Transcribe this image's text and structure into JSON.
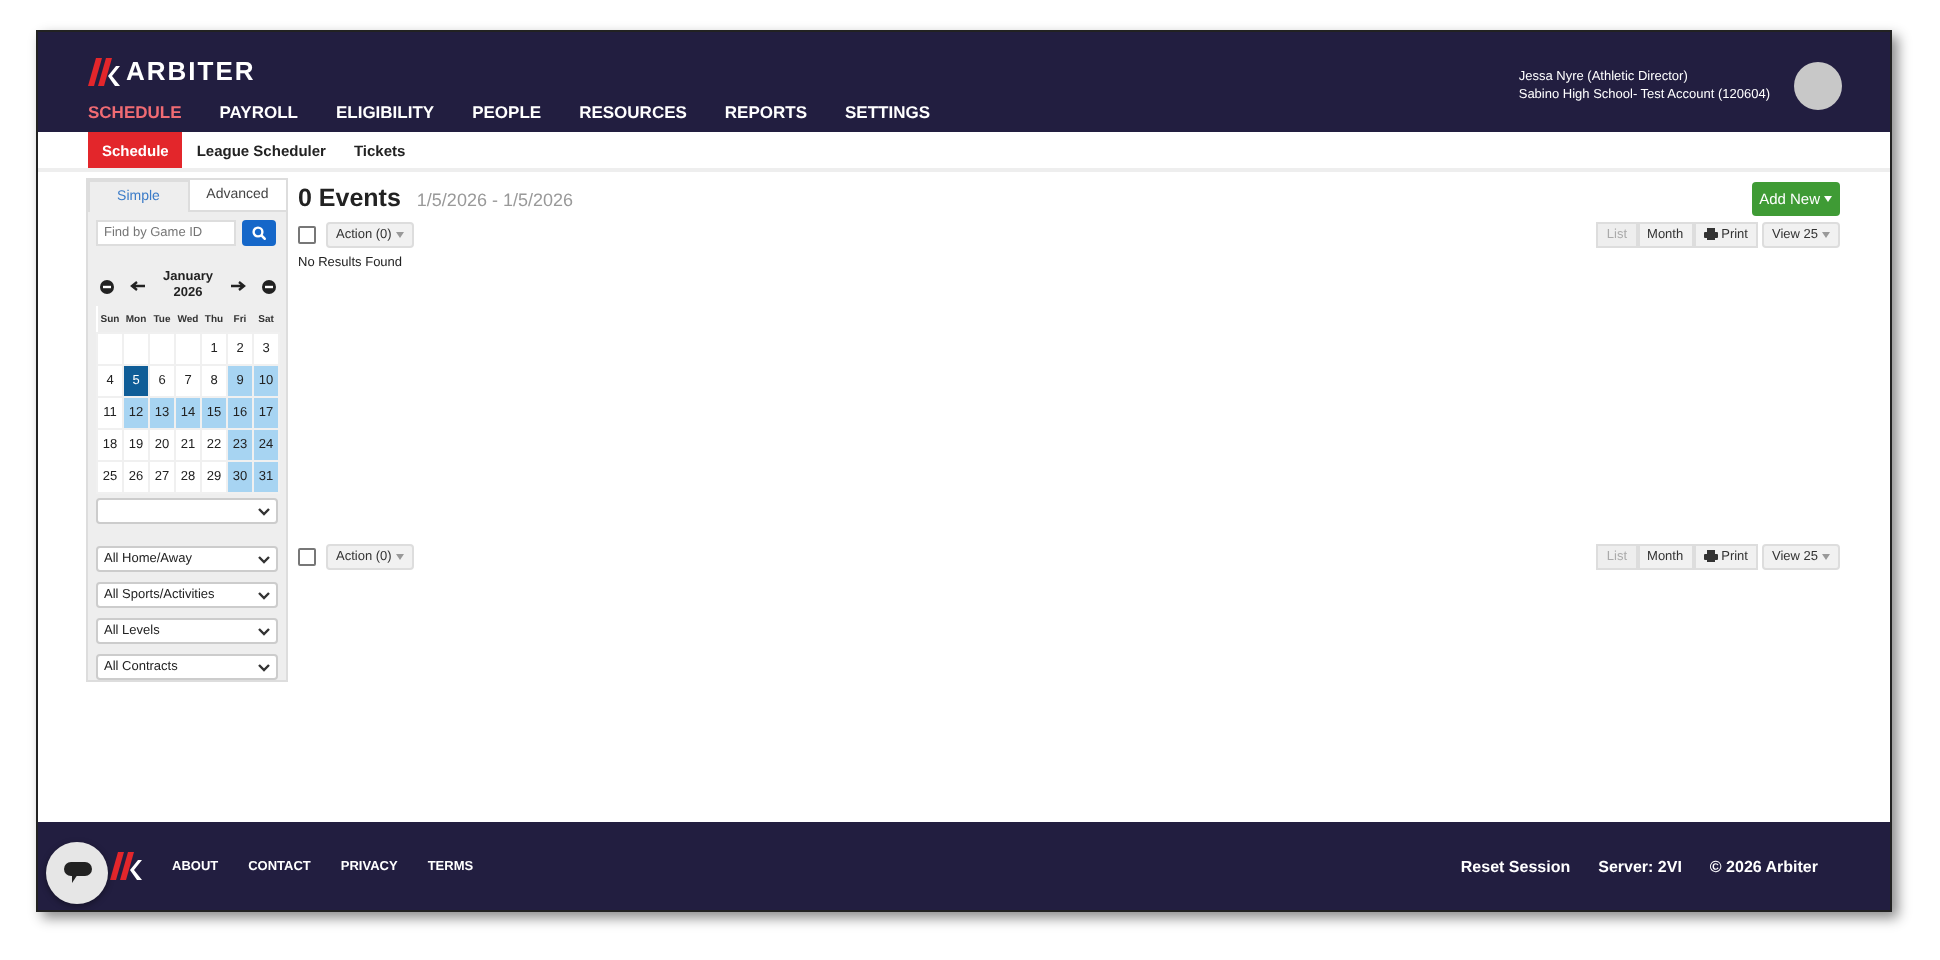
{
  "brand": {
    "name": "ARBITER"
  },
  "nav": [
    {
      "label": "SCHEDULE",
      "selected": true
    },
    {
      "label": "PAYROLL",
      "selected": false
    },
    {
      "label": "ELIGIBILITY",
      "selected": false
    },
    {
      "label": "PEOPLE",
      "selected": false
    },
    {
      "label": "RESOURCES",
      "selected": false
    },
    {
      "label": "REPORTS",
      "selected": false
    },
    {
      "label": "SETTINGS",
      "selected": false
    }
  ],
  "user": {
    "name": "Jessa Nyre (Athletic Director)",
    "account": "Sabino High School- Test Account (120604)"
  },
  "subnav": [
    {
      "label": "Schedule",
      "selected": true
    },
    {
      "label": "League Scheduler",
      "selected": false
    },
    {
      "label": "Tickets",
      "selected": false
    }
  ],
  "sidebar": {
    "tabs": [
      {
        "label": "Simple",
        "selected": true
      },
      {
        "label": "Advanced",
        "selected": false
      }
    ],
    "search": {
      "placeholder": "Find by Game ID"
    },
    "calendar": {
      "month": "January",
      "year": "2026",
      "weekdays": [
        "Sun",
        "Mon",
        "Tue",
        "Wed",
        "Thu",
        "Fri",
        "Sat"
      ],
      "weeks": [
        [
          {
            "day": "1",
            "selected": false,
            "highlighted": false
          },
          {
            "day": "2",
            "selected": false,
            "highlighted": false
          },
          {
            "day": "3",
            "selected": false,
            "highlighted": false
          }
        ],
        [
          {
            "day": "4",
            "selected": false,
            "highlighted": false
          },
          {
            "day": "5",
            "selected": true,
            "highlighted": false
          },
          {
            "day": "6",
            "selected": false,
            "highlighted": false
          },
          {
            "day": "7",
            "selected": false,
            "highlighted": false
          },
          {
            "day": "8",
            "selected": false,
            "highlighted": false
          },
          {
            "day": "9",
            "selected": false,
            "highlighted": true
          },
          {
            "day": "10",
            "selected": false,
            "highlighted": true
          }
        ],
        [
          {
            "day": "11",
            "selected": false,
            "highlighted": false
          },
          {
            "day": "12",
            "selected": false,
            "highlighted": true
          },
          {
            "day": "13",
            "selected": false,
            "highlighted": true
          },
          {
            "day": "14",
            "selected": false,
            "highlighted": true
          },
          {
            "day": "15",
            "selected": false,
            "highlighted": true
          },
          {
            "day": "16",
            "selected": false,
            "highlighted": true
          },
          {
            "day": "17",
            "selected": false,
            "highlighted": true
          }
        ],
        [
          {
            "day": "18",
            "selected": false,
            "highlighted": false
          },
          {
            "day": "19",
            "selected": false,
            "highlighted": false
          },
          {
            "day": "20",
            "selected": false,
            "highlighted": false
          },
          {
            "day": "21",
            "selected": false,
            "highlighted": false
          },
          {
            "day": "22",
            "selected": false,
            "highlighted": false
          },
          {
            "day": "23",
            "selected": false,
            "highlighted": true
          },
          {
            "day": "24",
            "selected": false,
            "highlighted": true
          }
        ],
        [
          {
            "day": "25",
            "selected": false,
            "highlighted": false
          },
          {
            "day": "26",
            "selected": false,
            "highlighted": false
          },
          {
            "day": "27",
            "selected": false,
            "highlighted": false
          },
          {
            "day": "28",
            "selected": false,
            "highlighted": false
          },
          {
            "day": "29",
            "selected": false,
            "highlighted": false
          },
          {
            "day": "30",
            "selected": false,
            "highlighted": true
          },
          {
            "day": "31",
            "selected": false,
            "highlighted": true
          }
        ]
      ]
    },
    "filters": [
      {
        "value": "All Home/Away"
      },
      {
        "value": "All Sports/Activities"
      },
      {
        "value": "All Levels"
      },
      {
        "value": "All Contracts"
      }
    ]
  },
  "events": {
    "title": "0 Events",
    "range": "1/5/2026 - 1/5/2026",
    "add_button": "Add New",
    "toolbars": [
      {
        "checked": false,
        "action": "Action (0)",
        "views": [
          {
            "label": "List",
            "selected": true
          },
          {
            "label": "Month",
            "selected": false
          }
        ],
        "print": "Print",
        "page_size": "View 25",
        "message": "No Results Found"
      },
      {
        "checked": false,
        "action": "Action (0)",
        "views": [
          {
            "label": "List",
            "selected": true
          },
          {
            "label": "Month",
            "selected": false
          }
        ],
        "print": "Print",
        "page_size": "View 25"
      }
    ]
  },
  "footer": {
    "links": [
      "ABOUT",
      "CONTACT",
      "PRIVACY",
      "TERMS"
    ],
    "reset": "Reset Session",
    "server": "Server: 2VI",
    "copyright": "© 2026 Arbiter"
  }
}
